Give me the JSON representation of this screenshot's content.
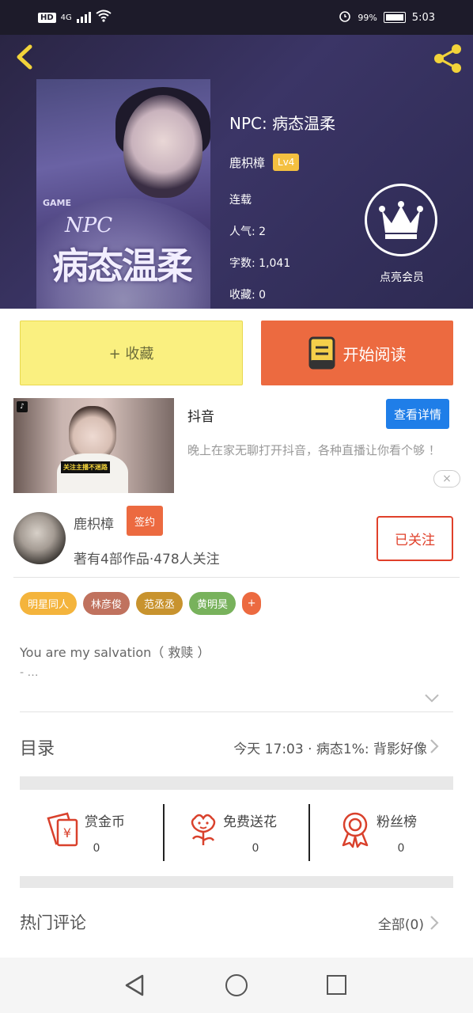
{
  "status_bar": {
    "network_badge": "HD",
    "network_type": "4G",
    "battery_percent": "99%",
    "time": "5:03"
  },
  "header": {
    "title": "NPC: 病态温柔",
    "author": "鹿枳樟",
    "level_badge": "Lv4",
    "status": "连载",
    "popularity": "人气: 2",
    "word_count": "字数: 1,041",
    "favorites": "收藏: 0",
    "vip_label": "点亮会员",
    "cover": {
      "subtitle": "NPC",
      "title": "病态温柔",
      "tagline": "GAME"
    }
  },
  "actions": {
    "favorite_label": "+ 收藏",
    "read_label": "开始阅读"
  },
  "ad": {
    "source": "抖音",
    "detail_button": "查看详情",
    "description": "晚上在家无聊打开抖音，各种直播让你看个够 ！",
    "thumb_caption": "关注主播不迷路",
    "close_icon": "×"
  },
  "author_card": {
    "name": "鹿枳樟",
    "sign_badge": "签约",
    "stats": "著有4部作品·478人关注",
    "follow_button": "已关注"
  },
  "tags": [
    {
      "label": "明星同人",
      "color": "#f4b43c"
    },
    {
      "label": "林彦俊",
      "color": "#c0725e"
    },
    {
      "label": "范丞丞",
      "color": "#c8932e"
    },
    {
      "label": "黄明昊",
      "color": "#78b25c"
    }
  ],
  "tag_more": "+",
  "intro": {
    "line1": "You are my salvation（ 救赎 ）",
    "line2": "- …"
  },
  "catalog": {
    "label": "目录",
    "latest": "今天 17:03 · 病态1%: 背影好像"
  },
  "gifts": [
    {
      "label": "赏金币",
      "count": "0",
      "icon": "coin-envelope-icon"
    },
    {
      "label": "免费送花",
      "count": "0",
      "icon": "flower-icon"
    },
    {
      "label": "粉丝榜",
      "count": "0",
      "icon": "medal-icon"
    }
  ],
  "comments": {
    "label": "热门评论",
    "all_label": "全部(0)"
  },
  "colors": {
    "accent_orange": "#ec6a40",
    "fav_yellow": "#faf080",
    "detail_blue": "#1f7ee8",
    "follow_red": "#e0402a",
    "header_purple": "#3b3566"
  }
}
